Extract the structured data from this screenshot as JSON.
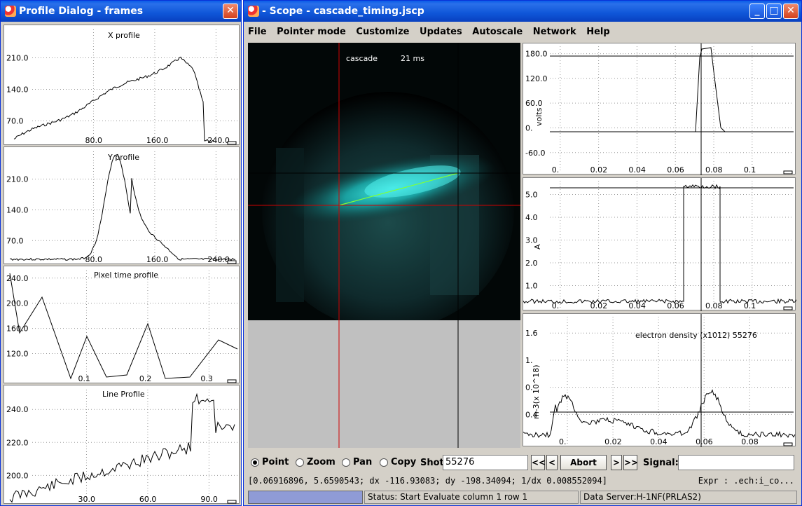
{
  "profile_dialog": {
    "title": "Profile Dialog - frames",
    "close_glyph": "✕",
    "panels": [
      {
        "title": "X profile",
        "yticks": [
          "210.0",
          "140.0",
          "70.0"
        ],
        "xticks": [
          "80.0",
          "160.0",
          "240.0"
        ]
      },
      {
        "title": "Y profile",
        "yticks": [
          "210.0",
          "140.0",
          "70.0"
        ],
        "xticks": [
          "80.0",
          "160.0",
          "240.0"
        ]
      },
      {
        "title": "Pixel time profile",
        "yticks": [
          "240.0",
          "200.0",
          "160.0",
          "120.0"
        ],
        "xticks": [
          "0.1",
          "0.2",
          "0.3"
        ]
      },
      {
        "title": "Line Profile",
        "yticks": [
          "240.0",
          "220.0",
          "200.0"
        ],
        "xticks": [
          "30.0",
          "60.0",
          "90.0"
        ]
      }
    ]
  },
  "scope": {
    "title": "- Scope - cascade_timing.jscp",
    "menu": [
      "File",
      "Pointer mode",
      "Customize",
      "Updates",
      "Autoscale",
      "Network",
      "Help"
    ],
    "frame": {
      "label": "cascade",
      "time": "21 ms"
    },
    "signals": [
      {
        "yticks": [
          "180.0",
          "120.0",
          "60.0",
          "0.",
          "-60.0"
        ],
        "ylabel": "volts",
        "xticks": [
          "0.",
          "0.02",
          "0.04",
          "0.06",
          "0.08",
          "0.1"
        ]
      },
      {
        "yticks": [
          "5.0",
          "4.0",
          "3.0",
          "2.0",
          "1.0"
        ],
        "ylabel": "A",
        "xticks": [
          "0.",
          "0.02",
          "0.04",
          "0.06",
          "0.08",
          "0.1"
        ]
      },
      {
        "yticks": [
          "1.6",
          "1.",
          "0.",
          "0.4"
        ],
        "ylabel": "m-3(x 10^18)",
        "xticks": [
          "0.",
          "0.02",
          "0.04",
          "0.06",
          "0.08"
        ],
        "label": "electron density (x1012) 55276"
      }
    ],
    "toolbar": {
      "modes": [
        "Point",
        "Zoom",
        "Pan",
        "Copy"
      ],
      "selected_mode": "Point",
      "shot_label": "Shot",
      "shot_value": "55276",
      "btn_first": "<<",
      "btn_prev": "<",
      "abort": "Abort",
      "btn_next": ">",
      "btn_last": ">>",
      "signal_label": "Signal:",
      "signal_value": ""
    },
    "coords": "[0.06916896, 5.6590543; dx -116.93083; dy -198.34094; 1/dx 0.008552094]",
    "expr": "Expr : .ech:i_co...",
    "status": "Status: Start Evaluate column 1 row 1",
    "server": "Data Server:H-1NF(PRLAS2)"
  }
}
